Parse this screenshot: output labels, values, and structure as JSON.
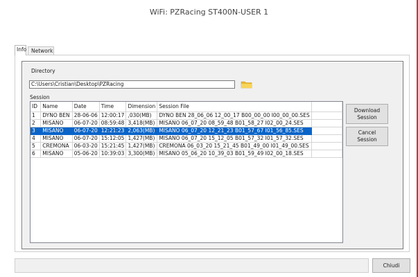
{
  "window": {
    "title": "WiFi: PZRacing ST400N-USER 1"
  },
  "tabs": [
    {
      "label": "Info",
      "active": true
    },
    {
      "label": "Network",
      "active": false
    }
  ],
  "directory": {
    "label": "Directory",
    "value": "C:\\Users\\Cristian\\Desktop\\PZRacing",
    "folder_icon": "folder-icon"
  },
  "session": {
    "label": "Session",
    "columns": [
      "ID",
      "Name",
      "Date",
      "Time",
      "Dimension",
      "Session File"
    ],
    "rows": [
      {
        "id": "1",
        "name": "DYNO BEN",
        "date": "28-06-06",
        "time": "12:00:17",
        "dimension": ",030(MB)",
        "file": "DYNO BEN 28_06_06 12_00_17 B00_00_00 I00_00_00.SES",
        "selected": false
      },
      {
        "id": "2",
        "name": "MISANO",
        "date": "06-07-20",
        "time": "08:59:48",
        "dimension": "3,418(MB)",
        "file": "MISANO  06_07_20 08_59_48 B01_58_27 I02_00_24.SES",
        "selected": false
      },
      {
        "id": "3",
        "name": "MISANO",
        "date": "06-07-20",
        "time": "12:21:23",
        "dimension": "2,063(MB)",
        "file": "MISANO  06_07_20 12_21_23 B01_57_67 I01_56_85.SES",
        "selected": true
      },
      {
        "id": "4",
        "name": "MISANO",
        "date": "06-07-20",
        "time": "15:12:05",
        "dimension": "1,427(MB)",
        "file": "MISANO  06_07_20 15_12_05 B01_57_32 I01_57_32.SES",
        "selected": false
      },
      {
        "id": "5",
        "name": "CREMONA",
        "date": "06-03-20",
        "time": "15:21:45",
        "dimension": "1,427(MB)",
        "file": "CREMONA  06_03_20 15_21_45 B01_49_00 I01_49_00.SES",
        "selected": false
      },
      {
        "id": "6",
        "name": "MISANO",
        "date": "05-06-20",
        "time": "10:39:03",
        "dimension": "3,300(MB)",
        "file": "MISANO  05_06_20 10_39_03 B01_59_49 I02_00_18.SES",
        "selected": false
      }
    ]
  },
  "buttons": {
    "download_line1": "Download",
    "download_line2": "Session",
    "cancel_line1": "Cancel",
    "cancel_line2": "Session",
    "close": "Chiudi"
  },
  "colors": {
    "selection": "#0a64c8",
    "window_accent": "#c0393b",
    "folder": "#f2c94c"
  }
}
